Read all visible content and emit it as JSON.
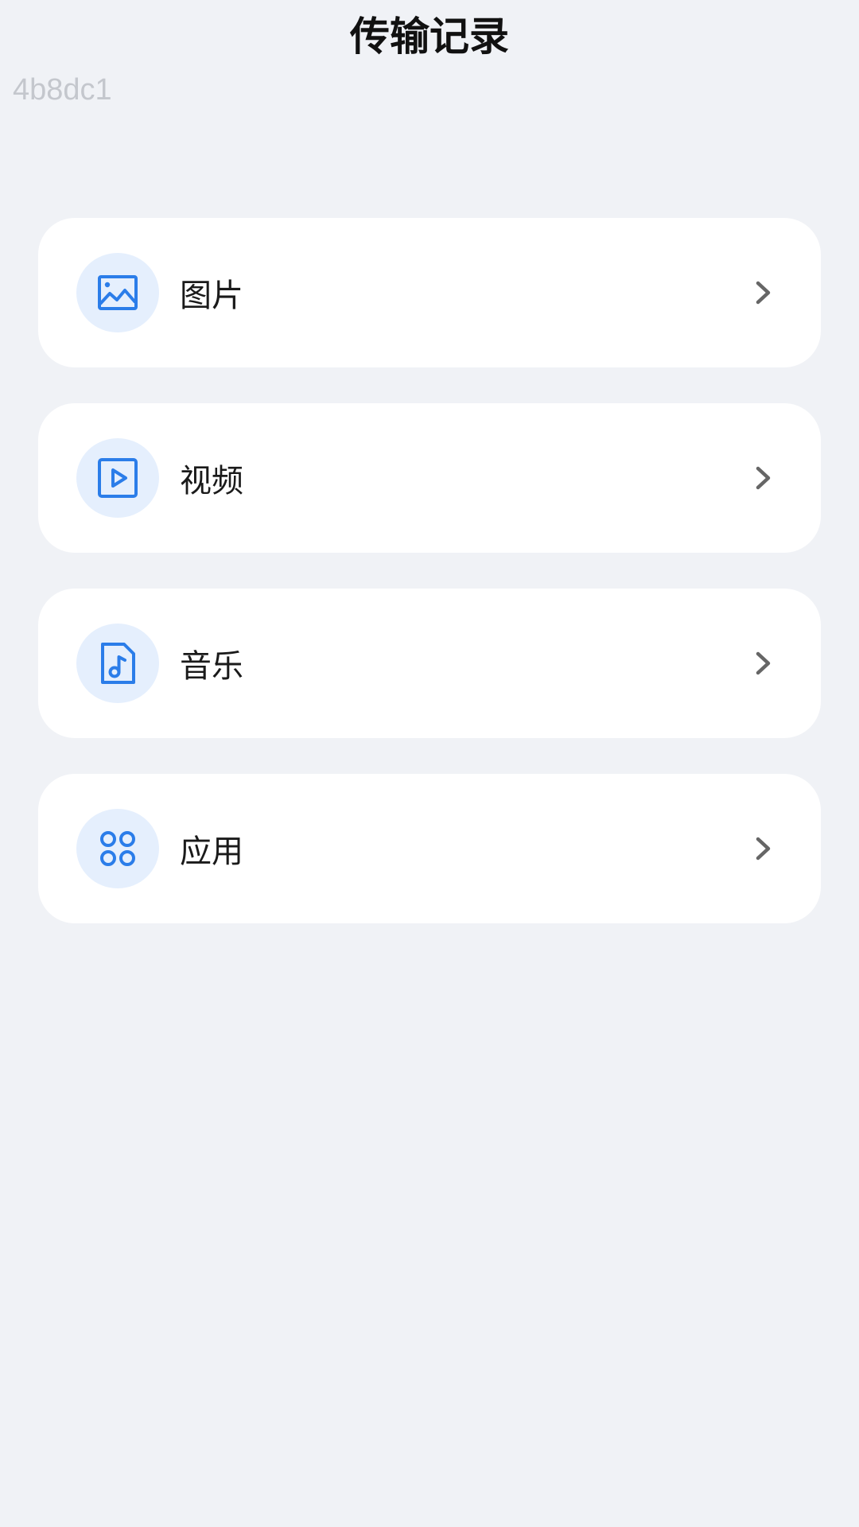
{
  "header": {
    "title": "传输记录",
    "device_id": "4b8dc1"
  },
  "categories": [
    {
      "label": "图片",
      "icon": "image-icon"
    },
    {
      "label": "视频",
      "icon": "video-play-icon"
    },
    {
      "label": "音乐",
      "icon": "music-file-icon"
    },
    {
      "label": "应用",
      "icon": "apps-grid-icon"
    }
  ],
  "colors": {
    "background": "#f0f2f6",
    "card": "#ffffff",
    "icon_bg": "#e5effd",
    "icon_accent": "#2b7de9",
    "chevron": "#666666"
  }
}
